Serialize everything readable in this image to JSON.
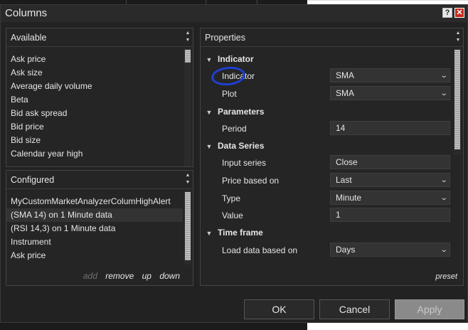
{
  "window": {
    "title": "Columns",
    "help_label": "?",
    "close_label": "✕"
  },
  "available": {
    "title": "Available",
    "items": [
      "Ask price",
      "Ask size",
      "Average daily volume",
      "Beta",
      "Bid ask spread",
      "Bid price",
      "Bid size",
      "Calendar year high"
    ]
  },
  "configured": {
    "title": "Configured",
    "items": [
      "MyCustomMarketAnalyzerColumHighAlert",
      "(SMA 14) on 1 Minute data",
      "(RSI 14,3) on 1 Minute data",
      "Instrument",
      "Ask price"
    ],
    "selected_index": 1,
    "links": {
      "add": "add",
      "remove": "remove",
      "up": "up",
      "down": "down"
    }
  },
  "properties": {
    "title": "Properties",
    "categories": {
      "indicator": "Indicator",
      "parameters": "Parameters",
      "data_series": "Data Series",
      "time_frame": "Time frame"
    },
    "rows": {
      "indicator": {
        "label": "Indicator",
        "value": "SMA"
      },
      "plot": {
        "label": "Plot",
        "value": "SMA"
      },
      "period": {
        "label": "Period",
        "value": "14"
      },
      "input_series": {
        "label": "Input series",
        "value": "Close"
      },
      "price_based_on": {
        "label": "Price based on",
        "value": "Last"
      },
      "type": {
        "label": "Type",
        "value": "Minute"
      },
      "value": {
        "label": "Value",
        "value": "1"
      },
      "load_data_based_on": {
        "label": "Load data based on",
        "value": "Days"
      }
    },
    "preset_label": "preset"
  },
  "buttons": {
    "ok": "OK",
    "cancel": "Cancel",
    "apply": "Apply"
  },
  "colors": {
    "background": "#222222",
    "panel": "#252525",
    "field": "#333333",
    "annotation": "#1f3fd6",
    "close": "#c42b1c"
  }
}
